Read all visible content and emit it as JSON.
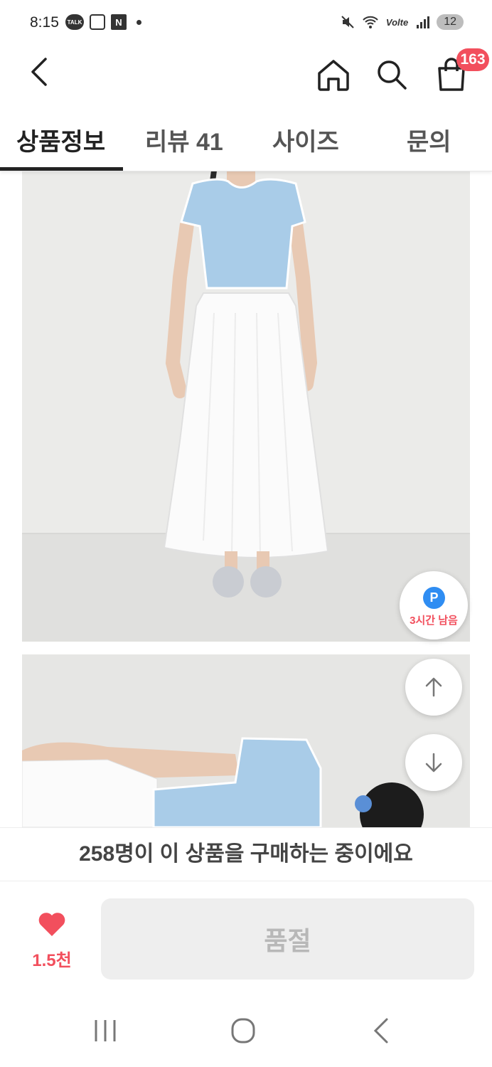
{
  "status_bar": {
    "time": "8:15",
    "talk_label": "TALK",
    "n_label": "N",
    "lte_label": "Volte",
    "battery": "12"
  },
  "nav": {
    "cart_count": "163"
  },
  "tabs": [
    {
      "label": "상품정보",
      "active": true
    },
    {
      "label": "리뷰 41",
      "active": false
    },
    {
      "label": "사이즈",
      "active": false
    },
    {
      "label": "문의",
      "active": false
    }
  ],
  "floating": {
    "point_letter": "P",
    "point_text": "3시간 남음"
  },
  "buyers_banner": "258명이 이 상품을 구매하는 중이에요",
  "actions": {
    "like_count": "1.5천",
    "soldout_label": "품절"
  },
  "colors": {
    "accent_red": "#f24f5d",
    "point_blue": "#2f8df2"
  }
}
